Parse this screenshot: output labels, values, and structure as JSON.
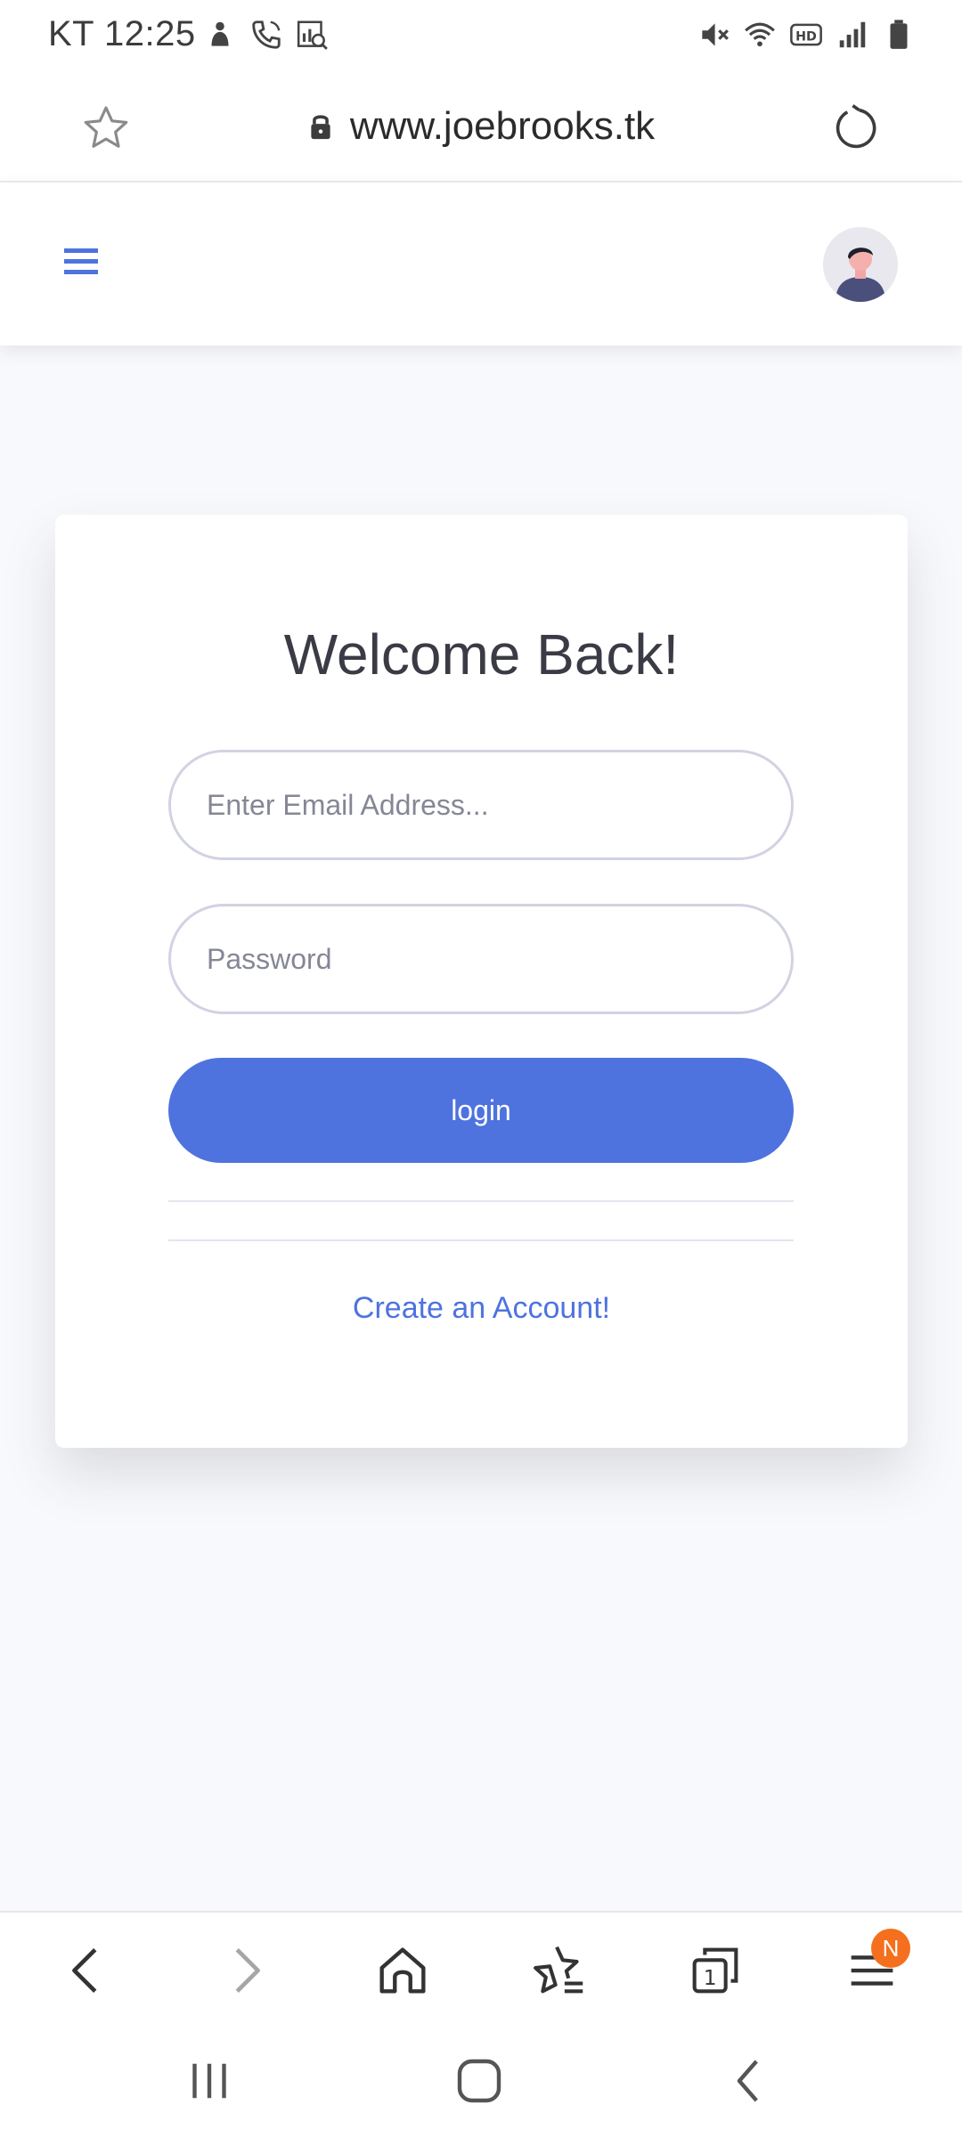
{
  "status_bar": {
    "time": "KT 12:25",
    "left_icons": [
      "app-notification-icon",
      "call-icon",
      "chart-search-icon"
    ],
    "right_icons": [
      "mute-icon",
      "wifi-icon",
      "hd-icon",
      "signal-icon",
      "battery-icon"
    ]
  },
  "browser": {
    "url": "www.joebrooks.tk",
    "icons": {
      "bookmark": "star-icon",
      "lock": "lock-icon",
      "reload": "reload-icon"
    }
  },
  "topbar": {
    "menu_icon": "hamburger-icon",
    "avatar": "user-avatar"
  },
  "login": {
    "heading": "Welcome Back!",
    "email_placeholder": "Enter Email Address...",
    "email_value": "",
    "password_placeholder": "Password",
    "password_value": "",
    "login_button": "login",
    "create_account_link": "Create an Account!"
  },
  "bottom_toolbar": {
    "items": [
      "back",
      "forward",
      "home",
      "bookmarks",
      "tabs",
      "menu"
    ],
    "tabs_count": "1",
    "menu_badge": "N"
  },
  "colors": {
    "primary": "#4e73df",
    "page_background": "#f8f9fc",
    "badge": "#f4701e",
    "input_border": "#d1d3e2"
  }
}
